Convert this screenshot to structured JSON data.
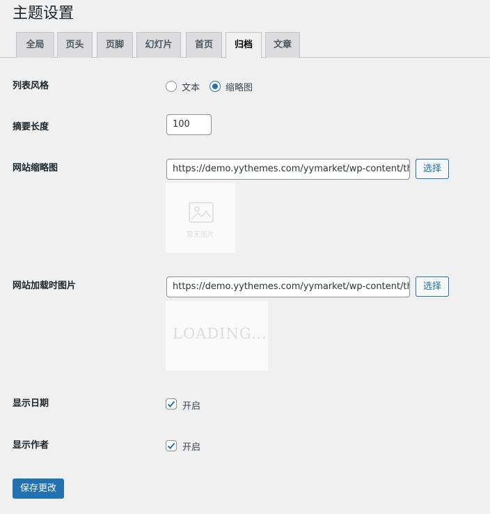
{
  "page_title": "主题设置",
  "tabs": [
    {
      "label": "全局"
    },
    {
      "label": "页头"
    },
    {
      "label": "页脚"
    },
    {
      "label": "幻灯片"
    },
    {
      "label": "首页"
    },
    {
      "label": "归档",
      "active": true
    },
    {
      "label": "文章"
    }
  ],
  "list_style": {
    "label": "列表风格",
    "options": [
      {
        "label": "文本",
        "checked": false
      },
      {
        "label": "缩略图",
        "checked": true
      }
    ]
  },
  "excerpt_length": {
    "label": "摘要长度",
    "value": "100"
  },
  "site_thumbnail": {
    "label": "网站缩略图",
    "value": "https://demo.yythemes.com/yymarket/wp-content/themes",
    "button": "选择",
    "placeholder_text": "暂无图片",
    "icon": "image-placeholder-icon"
  },
  "loading_image": {
    "label": "网站加载时图片",
    "value": "https://demo.yythemes.com/yymarket/wp-content/themes",
    "button": "选择",
    "preview_text": "LOADING..."
  },
  "show_date": {
    "label": "显示日期",
    "option": "开启",
    "checked": true
  },
  "show_author": {
    "label": "显示作者",
    "option": "开启",
    "checked": true
  },
  "save_button": "保存更改",
  "colors": {
    "accent": "#2271b1",
    "background": "#f0f0f1"
  }
}
